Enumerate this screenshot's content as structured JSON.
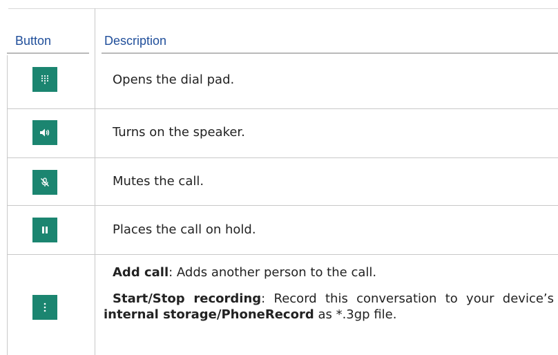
{
  "table": {
    "headers": {
      "button": "Button",
      "description": "Description"
    },
    "rows": [
      {
        "icon": "dialpad-icon",
        "description": "Opens the dial pad."
      },
      {
        "icon": "speaker-icon",
        "description": "Turns on the speaker."
      },
      {
        "icon": "mute-microphone-icon",
        "description": "Mutes the call."
      },
      {
        "icon": "pause-icon",
        "description": "Places the call on hold."
      },
      {
        "icon": "more-vertical-icon",
        "add_call_label": "Add call",
        "add_call_text": ": Adds another person to the call.",
        "recording_label": "Start/Stop recording",
        "recording_text_1": ": Record this conversation to your device’s ",
        "recording_path": "internal storage/PhoneRecord",
        "recording_text_2": " as *.3gp file."
      }
    ]
  },
  "colors": {
    "icon_bg": "#1b8570",
    "header_text": "#1f4e9a"
  }
}
